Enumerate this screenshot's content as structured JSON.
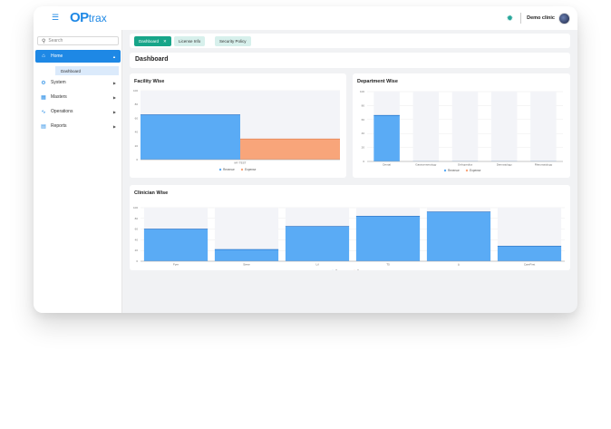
{
  "header": {
    "logo_a": "OP",
    "logo_b": "trax",
    "clinic": "Demo clinic"
  },
  "sidebar": {
    "search_placeholder": "Search",
    "items": [
      {
        "label": "Home"
      },
      {
        "label": "System"
      },
      {
        "label": "Masters"
      },
      {
        "label": "Operations"
      },
      {
        "label": "Reports"
      }
    ],
    "sub_item": "Dashboard"
  },
  "tabs": [
    {
      "label": "Dashboard"
    },
    {
      "label": "License Info"
    },
    {
      "label": "Security Policy"
    }
  ],
  "page_title": "Dashboard",
  "colors": {
    "primary": "#1e88e5",
    "teal": "#17a589",
    "bar_blue": "#5aabf5",
    "bar_orange": "#f8a57a"
  },
  "chart_data": [
    {
      "type": "bar",
      "title": "Facility Wise",
      "categories": [
        "MY TEST"
      ],
      "series": [
        {
          "name": "Revenue",
          "values": [
            65
          ]
        },
        {
          "name": "Expense",
          "values": [
            30
          ]
        }
      ],
      "ylim": [
        0,
        100
      ],
      "yticks": [
        "0",
        "20",
        "40",
        "60",
        "80",
        "100"
      ],
      "legend": "bottom"
    },
    {
      "type": "bar",
      "title": "Department Wise",
      "categories": [
        "Dental",
        "Gastroenterology",
        "Orthopedics",
        "Dermatology",
        "Rheumatology"
      ],
      "series": [
        {
          "name": "Revenue",
          "values": [
            66,
            0.3,
            0.3,
            0.3,
            0.3
          ]
        },
        {
          "name": "Expense",
          "values": [
            0,
            0,
            0,
            0,
            0
          ]
        }
      ],
      "ylim": [
        0,
        100
      ],
      "yticks": [
        "0",
        "20",
        "40",
        "60",
        "80",
        "100"
      ],
      "legend": "bottom"
    },
    {
      "type": "bar",
      "title": "Clinician Wise",
      "categories": [
        "Fyre",
        "Steve",
        "Lil",
        "T5",
        "Li",
        "CareFirst"
      ],
      "series": [
        {
          "name": "Revenue",
          "values": [
            60,
            22,
            65,
            84,
            92,
            28
          ]
        },
        {
          "name": "Expense",
          "values": [
            0,
            0,
            0,
            0,
            0,
            0
          ]
        }
      ],
      "ylim": [
        0,
        100
      ],
      "yticks": [
        "0",
        "20",
        "40",
        "60",
        "80",
        "100"
      ],
      "legend": "bottom"
    }
  ]
}
